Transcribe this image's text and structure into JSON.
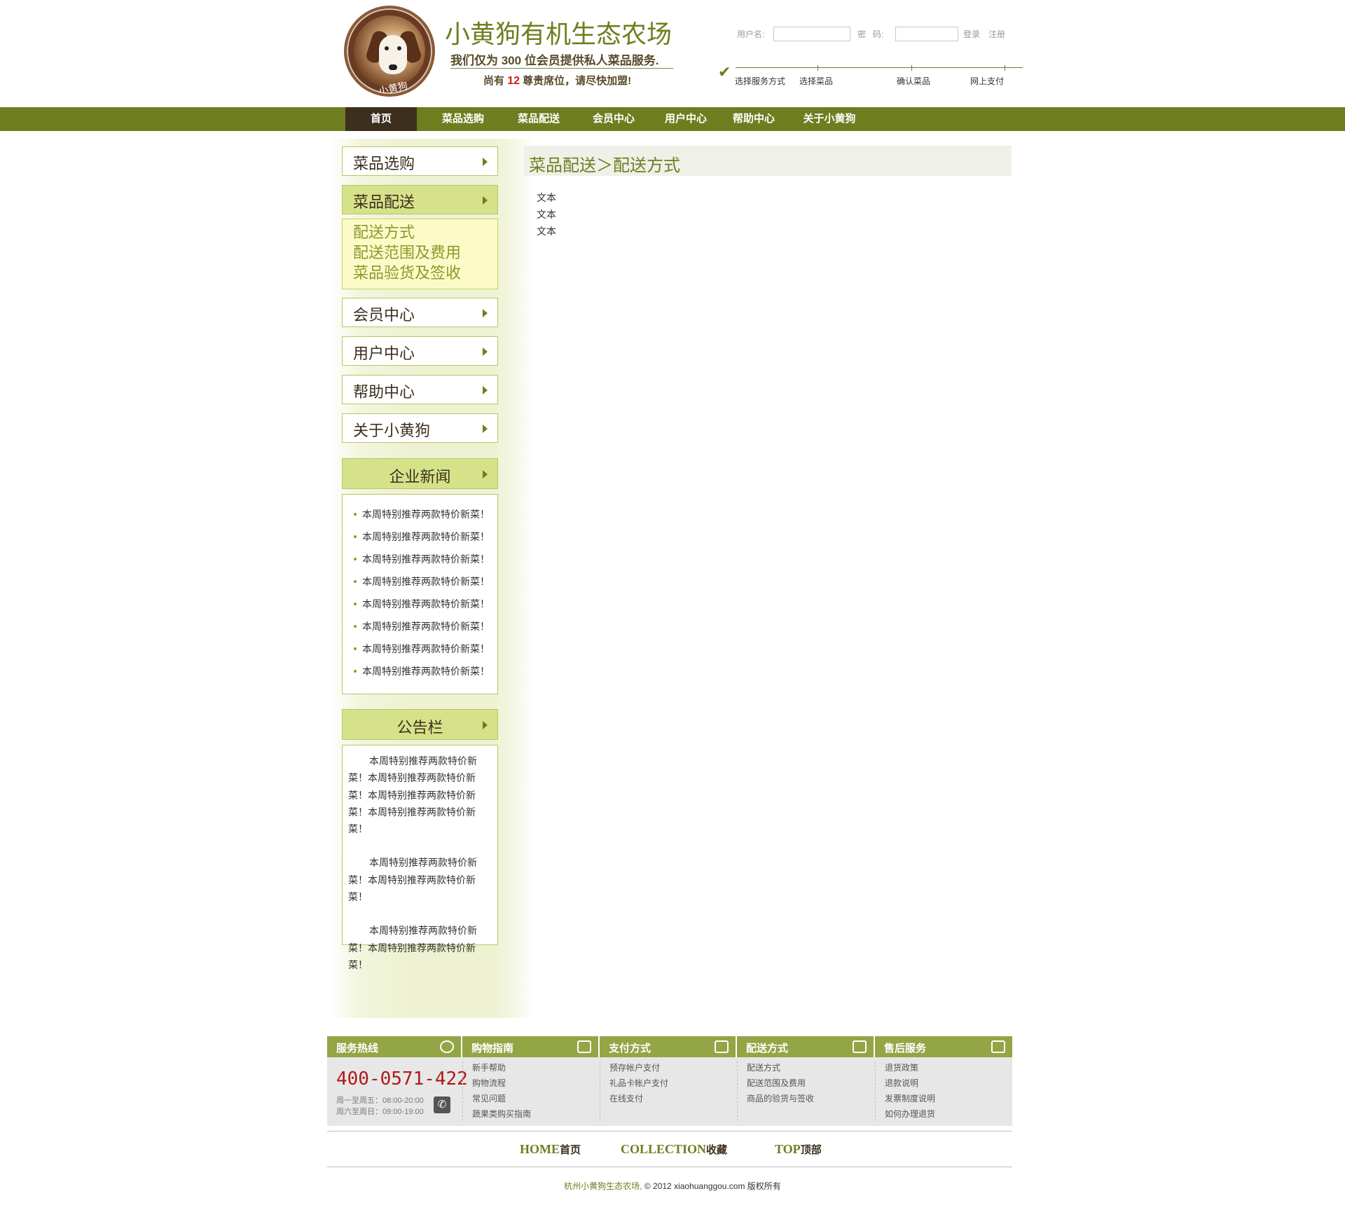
{
  "header": {
    "logo_text": "小黄狗",
    "site_title": "小黄狗有机生态农场",
    "slogan": "我们仅为 300 位会员提供私人菜品服务.",
    "seats_prefix": "尚有",
    "seats_count": "12",
    "seats_suffix": "尊贵席位，请尽快加盟!"
  },
  "login": {
    "username_label": "用户名:",
    "password_label": "密   码:",
    "login_link": "登录",
    "register_link": "注册",
    "username_value": "",
    "password_value": ""
  },
  "steps": {
    "labels": [
      "选择服务方式",
      "选择菜品",
      "确认菜品",
      "网上支付"
    ]
  },
  "nav": {
    "items": [
      "首页",
      "菜品选购",
      "菜品配送",
      "会员中心",
      "用户中心",
      "帮助中心",
      "关于小黄狗"
    ],
    "active": "首页"
  },
  "sidebar": {
    "menu": [
      "菜品选购",
      "菜品配送",
      "会员中心",
      "用户中心",
      "帮助中心",
      "关于小黄狗"
    ],
    "active_menu": "菜品配送",
    "submenu": [
      "配送方式",
      "配送范围及费用",
      "菜品验货及签收"
    ],
    "news_title": "企业新闻",
    "news": [
      "本周特别推荐两款特价新菜！",
      "本周特别推荐两款特价新菜！",
      "本周特别推荐两款特价新菜！",
      "本周特别推荐两款特价新菜！",
      "本周特别推荐两款特价新菜！",
      "本周特别推荐两款特价新菜！",
      "本周特别推荐两款特价新菜！",
      "本周特别推荐两款特价新菜！"
    ],
    "notice_title": "公告栏",
    "notices": [
      "本周特别推荐两款特价新菜！本周特别推荐两款特价新菜！本周特别推荐两款特价新菜！本周特别推荐两款特价新菜！",
      "本周特别推荐两款特价新菜！本周特别推荐两款特价新菜！",
      "本周特别推荐两款特价新菜！本周特别推荐两款特价新菜！"
    ]
  },
  "main": {
    "breadcrumb": "菜品配送＞配送方式",
    "lines": [
      "文本",
      "文本",
      "文本"
    ]
  },
  "footer": {
    "columns": [
      {
        "title": "服务热线",
        "icon": "clock-icon",
        "links": []
      },
      {
        "title": "购物指南",
        "icon": "book-icon",
        "links": [
          "新手帮助",
          "购物流程",
          "常见问题",
          "蔬果类购买指南"
        ]
      },
      {
        "title": "支付方式",
        "icon": "calendar-icon",
        "links": [
          "预存帐户支付",
          "礼品卡帐户支付",
          "在线支付"
        ]
      },
      {
        "title": "配送方式",
        "icon": "truck-icon",
        "links": [
          "配送方式",
          "配送范围及费用",
          "商品的验货与签收"
        ]
      },
      {
        "title": "售后服务",
        "icon": "service-icon",
        "links": [
          "退货政策",
          "退款说明",
          "发票制度说明",
          "如何办理退货"
        ]
      }
    ],
    "hotline": "400-0571-422",
    "hours_weekday": "周一至周五：08:00-20:00",
    "hours_weekend": "周六至周日：09:00-19:00",
    "nav_home_en": "HOME",
    "nav_home_zh": "首页",
    "nav_collect_en": "COLLECTION",
    "nav_collect_zh": "收藏",
    "nav_top_en": "TOP",
    "nav_top_zh": "顶部",
    "copyright_brand": "杭州小黄狗生态农场,",
    "copyright_rest": "© 2012 xiaohuanggou.com 版权所有"
  },
  "colors": {
    "brand_green": "#6e7e1f",
    "nav_active": "#3d2f1d",
    "sidebar_active": "#d6e28a",
    "footer_head": "#93a545",
    "hotline_red": "#b01818"
  }
}
